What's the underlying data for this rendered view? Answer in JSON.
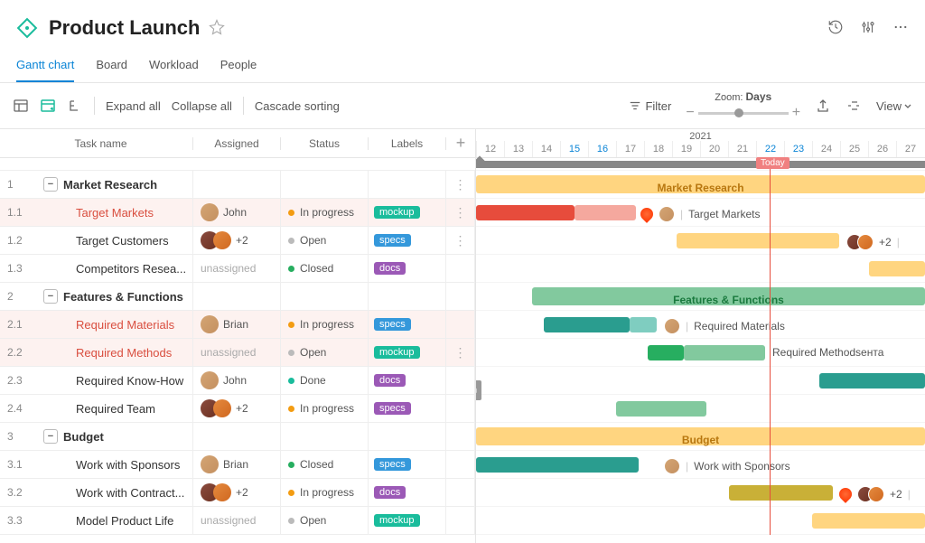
{
  "header": {
    "title": "Product Launch"
  },
  "tabs": [
    {
      "label": "Gantt chart",
      "active": true
    },
    {
      "label": "Board",
      "active": false
    },
    {
      "label": "Workload",
      "active": false
    },
    {
      "label": "People",
      "active": false
    }
  ],
  "toolbar": {
    "expand": "Expand all",
    "collapse": "Collapse all",
    "cascade": "Cascade sorting",
    "filter": "Filter",
    "zoom_label": "Zoom:",
    "zoom_value": "Days",
    "view": "View"
  },
  "columns": {
    "name": "Task name",
    "assigned": "Assigned",
    "status": "Status",
    "labels": "Labels"
  },
  "timeline": {
    "year": "2021",
    "days": [
      "12",
      "13",
      "14",
      "15",
      "16",
      "17",
      "18",
      "19",
      "20",
      "21",
      "22",
      "23",
      "24",
      "25",
      "26",
      "27"
    ],
    "highlight_days": [
      "15",
      "16",
      "22",
      "23"
    ],
    "today": "22",
    "today_label": "Today"
  },
  "statuses": {
    "in_progress": "In progress",
    "open": "Open",
    "closed": "Closed",
    "done": "Done"
  },
  "labels_chips": {
    "mockup": "mockup",
    "specs": "specs",
    "docs": "docs"
  },
  "assignees": {
    "john": "John",
    "brian": "Brian",
    "unassigned": "unassigned",
    "plus2": "+2"
  },
  "tasks": [
    {
      "num": "1",
      "name": "Market Research",
      "type": "group"
    },
    {
      "num": "1.1",
      "name": "Target Markets",
      "assigned": "John",
      "status": "In progress",
      "label": "mockup",
      "red": true
    },
    {
      "num": "1.2",
      "name": "Target Customers",
      "assigned": "+2",
      "status": "Open",
      "label": "specs"
    },
    {
      "num": "1.3",
      "name": "Competitors Resea...",
      "assigned": "unassigned",
      "status": "Closed",
      "label": "docs"
    },
    {
      "num": "2",
      "name": "Features & Functions",
      "type": "group"
    },
    {
      "num": "2.1",
      "name": "Required Materials",
      "assigned": "Brian",
      "status": "In progress",
      "label": "specs",
      "red": true
    },
    {
      "num": "2.2",
      "name": "Required Methods",
      "assigned": "unassigned",
      "status": "Open",
      "label": "mockup",
      "red": true
    },
    {
      "num": "2.3",
      "name": "Required Know-How",
      "assigned": "John",
      "status": "Done",
      "label": "docs"
    },
    {
      "num": "2.4",
      "name": "Required Team",
      "assigned": "+2",
      "status": "In progress",
      "label": "specs"
    },
    {
      "num": "3",
      "name": "Budget",
      "type": "group"
    },
    {
      "num": "3.1",
      "name": "Work with Sponsors",
      "assigned": "Brian",
      "status": "Closed",
      "label": "specs"
    },
    {
      "num": "3.2",
      "name": "Work with Contract...",
      "assigned": "+2",
      "status": "In progress",
      "label": "docs"
    },
    {
      "num": "3.3",
      "name": "Model Product Life",
      "assigned": "unassigned",
      "status": "Open",
      "label": "mockup"
    }
  ],
  "gantt": {
    "summary_labels": {
      "market": "Market Research",
      "features": "Features & Functions",
      "budget": "Budget"
    },
    "bar_labels": {
      "target_markets": "Target Markets",
      "required_materials": "Required Materials",
      "required_methods": "Required Methodsента",
      "work_with_sponsors": "Work with Sponsors"
    }
  },
  "chart_data": {
    "type": "gantt",
    "x_unit": "day",
    "x_range": [
      12,
      27
    ],
    "today": 22,
    "groups": [
      {
        "name": "Market Research",
        "start": 12,
        "end": 27,
        "color": "#ffd580"
      },
      {
        "name": "Features & Functions",
        "start": 14,
        "end": 27,
        "color": "#82c99e"
      },
      {
        "name": "Budget",
        "start": 12,
        "end": 27,
        "color": "#ffd580"
      }
    ],
    "bars": [
      {
        "name": "Target Markets",
        "group": "Market Research",
        "start": 12,
        "end": 18,
        "progress_end": 15,
        "color": "#e74c3c",
        "overdue": true
      },
      {
        "name": "Target Customers",
        "group": "Market Research",
        "start": 19,
        "end": 25,
        "color": "#ffd580"
      },
      {
        "name": "Competitors Research",
        "group": "Market Research",
        "start": 26,
        "end": 27,
        "color": "#ffd580"
      },
      {
        "name": "Required Materials",
        "group": "Features & Functions",
        "start": 14,
        "end": 18,
        "progress_end": 17,
        "color": "#2a9d8f"
      },
      {
        "name": "Required Methods",
        "group": "Features & Functions",
        "start": 18,
        "end": 22,
        "progress_end": 19,
        "color": "#82c99e"
      },
      {
        "name": "Required Know-How",
        "group": "Features & Functions",
        "start": 24,
        "end": 27,
        "color": "#2a9d8f"
      },
      {
        "name": "Required Team",
        "group": "Features & Functions",
        "start": 17,
        "end": 20,
        "color": "#82c99e"
      },
      {
        "name": "Work with Sponsors",
        "group": "Budget",
        "start": 12,
        "end": 18,
        "color": "#2a9d8f"
      },
      {
        "name": "Work with Contractors",
        "group": "Budget",
        "start": 21,
        "end": 25,
        "color": "#c9b037",
        "overdue": true
      },
      {
        "name": "Model Product Life",
        "group": "Budget",
        "start": 24,
        "end": 27,
        "color": "#ffd580"
      }
    ]
  }
}
